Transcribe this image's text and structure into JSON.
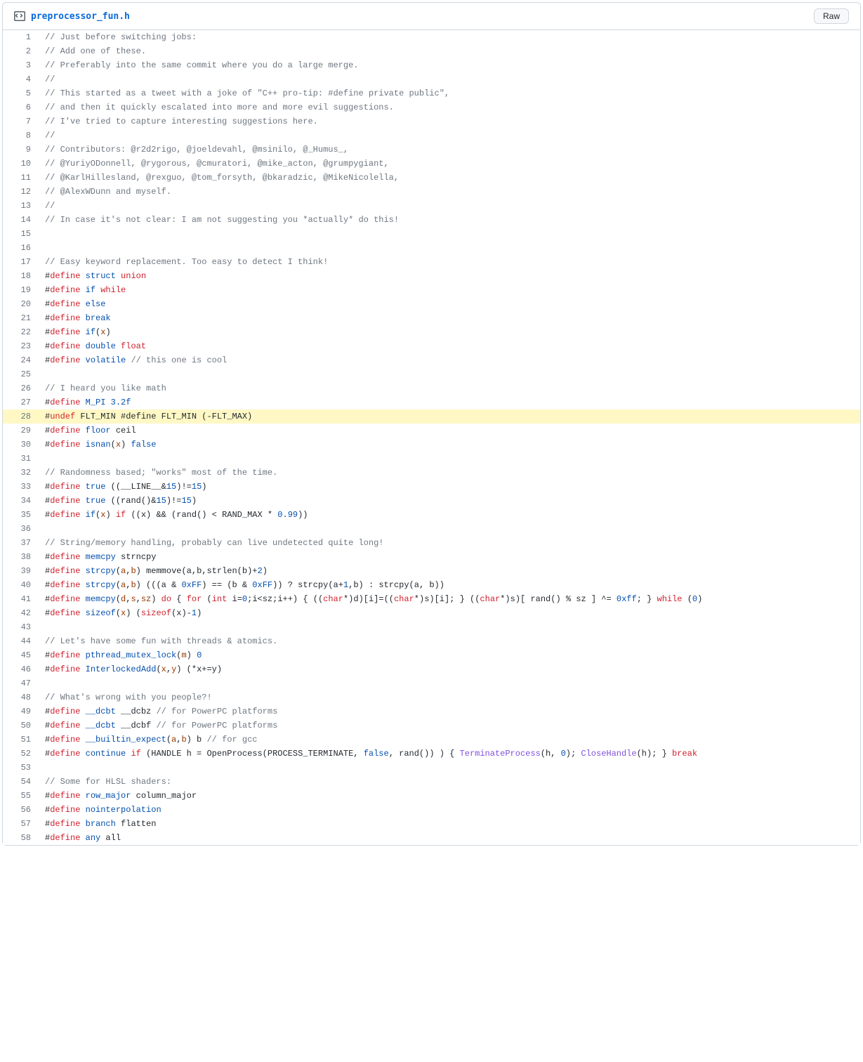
{
  "header": {
    "filename": "preprocessor_fun.h",
    "raw_label": "Raw"
  },
  "highlight_line": 28,
  "code": [
    {
      "n": 1,
      "t": [
        [
          "c-cm",
          "// Just before switching jobs:"
        ]
      ]
    },
    {
      "n": 2,
      "t": [
        [
          "c-cm",
          "// Add one of these."
        ]
      ]
    },
    {
      "n": 3,
      "t": [
        [
          "c-cm",
          "// Preferably into the same commit where you do a large merge."
        ]
      ]
    },
    {
      "n": 4,
      "t": [
        [
          "c-cm",
          "//"
        ]
      ]
    },
    {
      "n": 5,
      "t": [
        [
          "c-cm",
          "// This started as a tweet with a joke of \"C++ pro-tip: #define private public\","
        ]
      ]
    },
    {
      "n": 6,
      "t": [
        [
          "c-cm",
          "// and then it quickly escalated into more and more evil suggestions."
        ]
      ]
    },
    {
      "n": 7,
      "t": [
        [
          "c-cm",
          "// I've tried to capture interesting suggestions here."
        ]
      ]
    },
    {
      "n": 8,
      "t": [
        [
          "c-cm",
          "//"
        ]
      ]
    },
    {
      "n": 9,
      "t": [
        [
          "c-cm",
          "// Contributors: @r2d2rigo, @joeldevahl, @msinilo, @_Humus_,"
        ]
      ]
    },
    {
      "n": 10,
      "t": [
        [
          "c-cm",
          "// @YuriyODonnell, @rygorous, @cmuratori, @mike_acton, @grumpygiant,"
        ]
      ]
    },
    {
      "n": 11,
      "t": [
        [
          "c-cm",
          "// @KarlHillesland, @rexguo, @tom_forsyth, @bkaradzic, @MikeNicolella,"
        ]
      ]
    },
    {
      "n": 12,
      "t": [
        [
          "c-cm",
          "// @AlexWDunn and myself."
        ]
      ]
    },
    {
      "n": 13,
      "t": [
        [
          "c-cm",
          "//"
        ]
      ]
    },
    {
      "n": 14,
      "t": [
        [
          "c-cm",
          "// In case it's not clear: I am not suggesting you *actually* do this!"
        ]
      ]
    },
    {
      "n": 15,
      "t": [
        [
          "",
          ""
        ]
      ]
    },
    {
      "n": 16,
      "t": [
        [
          "",
          ""
        ]
      ]
    },
    {
      "n": 17,
      "t": [
        [
          "c-cm",
          "// Easy keyword replacement. Too easy to detect I think!"
        ]
      ]
    },
    {
      "n": 18,
      "t": [
        [
          "",
          "#"
        ],
        [
          "c-kw",
          "define"
        ],
        [
          "",
          " "
        ],
        [
          "c-nm",
          "struct"
        ],
        [
          "",
          " "
        ],
        [
          "c-kw",
          "union"
        ]
      ]
    },
    {
      "n": 19,
      "t": [
        [
          "",
          "#"
        ],
        [
          "c-kw",
          "define"
        ],
        [
          "",
          " "
        ],
        [
          "c-nm",
          "if"
        ],
        [
          "",
          " "
        ],
        [
          "c-kw",
          "while"
        ]
      ]
    },
    {
      "n": 20,
      "t": [
        [
          "",
          "#"
        ],
        [
          "c-kw",
          "define"
        ],
        [
          "",
          " "
        ],
        [
          "c-nm",
          "else"
        ]
      ]
    },
    {
      "n": 21,
      "t": [
        [
          "",
          "#"
        ],
        [
          "c-kw",
          "define"
        ],
        [
          "",
          " "
        ],
        [
          "c-nm",
          "break"
        ]
      ]
    },
    {
      "n": 22,
      "t": [
        [
          "",
          "#"
        ],
        [
          "c-kw",
          "define"
        ],
        [
          "",
          " "
        ],
        [
          "c-nm",
          "if"
        ],
        [
          "",
          "("
        ],
        [
          "c-var",
          "x"
        ],
        [
          "",
          ")"
        ]
      ]
    },
    {
      "n": 23,
      "t": [
        [
          "",
          "#"
        ],
        [
          "c-kw",
          "define"
        ],
        [
          "",
          " "
        ],
        [
          "c-nm",
          "double"
        ],
        [
          "",
          " "
        ],
        [
          "c-kw",
          "float"
        ]
      ]
    },
    {
      "n": 24,
      "t": [
        [
          "",
          "#"
        ],
        [
          "c-kw",
          "define"
        ],
        [
          "",
          " "
        ],
        [
          "c-nm",
          "volatile"
        ],
        [
          "",
          " "
        ],
        [
          "c-cm",
          "// this one is cool"
        ]
      ]
    },
    {
      "n": 25,
      "t": [
        [
          "",
          ""
        ]
      ]
    },
    {
      "n": 26,
      "t": [
        [
          "c-cm",
          "// I heard you like math"
        ]
      ]
    },
    {
      "n": 27,
      "t": [
        [
          "",
          "#"
        ],
        [
          "c-kw",
          "define"
        ],
        [
          "",
          " "
        ],
        [
          "c-nm",
          "M_PI"
        ],
        [
          "",
          " "
        ],
        [
          "c-num",
          "3.2f"
        ]
      ]
    },
    {
      "n": 28,
      "t": [
        [
          "",
          "#"
        ],
        [
          "c-kw",
          "undef"
        ],
        [
          "",
          " FLT_MIN #define FLT_MIN (-FLT_MAX)"
        ]
      ]
    },
    {
      "n": 29,
      "t": [
        [
          "",
          "#"
        ],
        [
          "c-kw",
          "define"
        ],
        [
          "",
          " "
        ],
        [
          "c-nm",
          "floor"
        ],
        [
          "",
          " ceil"
        ]
      ]
    },
    {
      "n": 30,
      "t": [
        [
          "",
          "#"
        ],
        [
          "c-kw",
          "define"
        ],
        [
          "",
          " "
        ],
        [
          "c-nm",
          "isnan"
        ],
        [
          "",
          "("
        ],
        [
          "c-var",
          "x"
        ],
        [
          "",
          ") "
        ],
        [
          "c-num",
          "false"
        ]
      ]
    },
    {
      "n": 31,
      "t": [
        [
          "",
          ""
        ]
      ]
    },
    {
      "n": 32,
      "t": [
        [
          "c-cm",
          "// Randomness based; \"works\" most of the time."
        ]
      ]
    },
    {
      "n": 33,
      "t": [
        [
          "",
          "#"
        ],
        [
          "c-kw",
          "define"
        ],
        [
          "",
          " "
        ],
        [
          "c-nm",
          "true"
        ],
        [
          "",
          " ((__LINE__&"
        ],
        [
          "c-num",
          "15"
        ],
        [
          "",
          ")!="
        ],
        [
          "c-num",
          "15"
        ],
        [
          "",
          ")"
        ]
      ]
    },
    {
      "n": 34,
      "t": [
        [
          "",
          "#"
        ],
        [
          "c-kw",
          "define"
        ],
        [
          "",
          " "
        ],
        [
          "c-nm",
          "true"
        ],
        [
          "",
          " ((rand()&"
        ],
        [
          "c-num",
          "15"
        ],
        [
          "",
          ")!="
        ],
        [
          "c-num",
          "15"
        ],
        [
          "",
          ")"
        ]
      ]
    },
    {
      "n": 35,
      "t": [
        [
          "",
          "#"
        ],
        [
          "c-kw",
          "define"
        ],
        [
          "",
          " "
        ],
        [
          "c-nm",
          "if"
        ],
        [
          "",
          "("
        ],
        [
          "c-var",
          "x"
        ],
        [
          "",
          ") "
        ],
        [
          "c-kw",
          "if"
        ],
        [
          "",
          " ((x) && (rand() < RAND_MAX * "
        ],
        [
          "c-num",
          "0.99"
        ],
        [
          "",
          "))"
        ]
      ]
    },
    {
      "n": 36,
      "t": [
        [
          "",
          ""
        ]
      ]
    },
    {
      "n": 37,
      "t": [
        [
          "c-cm",
          "// String/memory handling, probably can live undetected quite long!"
        ]
      ]
    },
    {
      "n": 38,
      "t": [
        [
          "",
          "#"
        ],
        [
          "c-kw",
          "define"
        ],
        [
          "",
          " "
        ],
        [
          "c-nm",
          "memcpy"
        ],
        [
          "",
          " strncpy"
        ]
      ]
    },
    {
      "n": 39,
      "t": [
        [
          "",
          "#"
        ],
        [
          "c-kw",
          "define"
        ],
        [
          "",
          " "
        ],
        [
          "c-nm",
          "strcpy"
        ],
        [
          "",
          "("
        ],
        [
          "c-var",
          "a"
        ],
        [
          "",
          ","
        ],
        [
          "c-var",
          "b"
        ],
        [
          "",
          ") memmove(a,b,strlen(b)+"
        ],
        [
          "c-num",
          "2"
        ],
        [
          "",
          ")"
        ]
      ]
    },
    {
      "n": 40,
      "t": [
        [
          "",
          "#"
        ],
        [
          "c-kw",
          "define"
        ],
        [
          "",
          " "
        ],
        [
          "c-nm",
          "strcpy"
        ],
        [
          "",
          "("
        ],
        [
          "c-var",
          "a"
        ],
        [
          "",
          ","
        ],
        [
          "c-var",
          "b"
        ],
        [
          "",
          ") (((a & "
        ],
        [
          "c-num",
          "0xFF"
        ],
        [
          "",
          ") == (b & "
        ],
        [
          "c-num",
          "0xFF"
        ],
        [
          "",
          ")) ? strcpy(a+"
        ],
        [
          "c-num",
          "1"
        ],
        [
          "",
          ",b) : strcpy(a, b))"
        ]
      ]
    },
    {
      "n": 41,
      "t": [
        [
          "",
          "#"
        ],
        [
          "c-kw",
          "define"
        ],
        [
          "",
          " "
        ],
        [
          "c-nm",
          "memcpy"
        ],
        [
          "",
          "("
        ],
        [
          "c-var",
          "d"
        ],
        [
          "",
          ","
        ],
        [
          "c-var",
          "s"
        ],
        [
          "",
          ","
        ],
        [
          "c-var",
          "sz"
        ],
        [
          "",
          ") "
        ],
        [
          "c-kw",
          "do"
        ],
        [
          "",
          " { "
        ],
        [
          "c-kw",
          "for"
        ],
        [
          "",
          " ("
        ],
        [
          "c-kw",
          "int"
        ],
        [
          "",
          " i="
        ],
        [
          "c-num",
          "0"
        ],
        [
          "",
          ";i<sz;i++) { (("
        ],
        [
          "c-kw",
          "char"
        ],
        [
          "",
          "*)d)[i]=(("
        ],
        [
          "c-kw",
          "char"
        ],
        [
          "",
          "*)s)[i]; } (("
        ],
        [
          "c-kw",
          "char"
        ],
        [
          "",
          "*)s)[ rand() % sz ] ^= "
        ],
        [
          "c-num",
          "0xff"
        ],
        [
          "",
          "; } "
        ],
        [
          "c-kw",
          "while"
        ],
        [
          "",
          " ("
        ],
        [
          "c-num",
          "0"
        ],
        [
          "",
          ")"
        ]
      ]
    },
    {
      "n": 42,
      "t": [
        [
          "",
          "#"
        ],
        [
          "c-kw",
          "define"
        ],
        [
          "",
          " "
        ],
        [
          "c-nm",
          "sizeof"
        ],
        [
          "",
          "("
        ],
        [
          "c-var",
          "x"
        ],
        [
          "",
          ") ("
        ],
        [
          "c-kw",
          "sizeof"
        ],
        [
          "",
          "(x)-"
        ],
        [
          "c-num",
          "1"
        ],
        [
          "",
          ")"
        ]
      ]
    },
    {
      "n": 43,
      "t": [
        [
          "",
          ""
        ]
      ]
    },
    {
      "n": 44,
      "t": [
        [
          "c-cm",
          "// Let's have some fun with threads & atomics."
        ]
      ]
    },
    {
      "n": 45,
      "t": [
        [
          "",
          "#"
        ],
        [
          "c-kw",
          "define"
        ],
        [
          "",
          " "
        ],
        [
          "c-nm",
          "pthread_mutex_lock"
        ],
        [
          "",
          "("
        ],
        [
          "c-var",
          "m"
        ],
        [
          "",
          ") "
        ],
        [
          "c-num",
          "0"
        ]
      ]
    },
    {
      "n": 46,
      "t": [
        [
          "",
          "#"
        ],
        [
          "c-kw",
          "define"
        ],
        [
          "",
          " "
        ],
        [
          "c-nm",
          "InterlockedAdd"
        ],
        [
          "",
          "("
        ],
        [
          "c-var",
          "x"
        ],
        [
          "",
          ","
        ],
        [
          "c-var",
          "y"
        ],
        [
          "",
          ") (*x+=y)"
        ]
      ]
    },
    {
      "n": 47,
      "t": [
        [
          "",
          ""
        ]
      ]
    },
    {
      "n": 48,
      "t": [
        [
          "c-cm",
          "// What's wrong with you people?!"
        ]
      ]
    },
    {
      "n": 49,
      "t": [
        [
          "",
          "#"
        ],
        [
          "c-kw",
          "define"
        ],
        [
          "",
          " "
        ],
        [
          "c-nm",
          "__dcbt"
        ],
        [
          "",
          " __dcbz "
        ],
        [
          "c-cm",
          "// for PowerPC platforms"
        ]
      ]
    },
    {
      "n": 50,
      "t": [
        [
          "",
          "#"
        ],
        [
          "c-kw",
          "define"
        ],
        [
          "",
          " "
        ],
        [
          "c-nm",
          "__dcbt"
        ],
        [
          "",
          " __dcbf "
        ],
        [
          "c-cm",
          "// for PowerPC platforms"
        ]
      ]
    },
    {
      "n": 51,
      "t": [
        [
          "",
          "#"
        ],
        [
          "c-kw",
          "define"
        ],
        [
          "",
          " "
        ],
        [
          "c-nm",
          "__builtin_expect"
        ],
        [
          "",
          "("
        ],
        [
          "c-var",
          "a"
        ],
        [
          "",
          ","
        ],
        [
          "c-var",
          "b"
        ],
        [
          "",
          ") b "
        ],
        [
          "c-cm",
          "// for gcc"
        ]
      ]
    },
    {
      "n": 52,
      "t": [
        [
          "",
          "#"
        ],
        [
          "c-kw",
          "define"
        ],
        [
          "",
          " "
        ],
        [
          "c-nm",
          "continue"
        ],
        [
          "",
          " "
        ],
        [
          "c-kw",
          "if"
        ],
        [
          "",
          " (HANDLE h = OpenProcess(PROCESS_TERMINATE, "
        ],
        [
          "c-num",
          "false"
        ],
        [
          "",
          ", rand()) ) { "
        ],
        [
          "c-fn",
          "TerminateProcess"
        ],
        [
          "",
          "(h, "
        ],
        [
          "c-num",
          "0"
        ],
        [
          "",
          "); "
        ],
        [
          "c-fn",
          "CloseHandle"
        ],
        [
          "",
          "(h); } "
        ],
        [
          "c-kw",
          "break"
        ]
      ]
    },
    {
      "n": 53,
      "t": [
        [
          "",
          ""
        ]
      ]
    },
    {
      "n": 54,
      "t": [
        [
          "c-cm",
          "// Some for HLSL shaders:"
        ]
      ]
    },
    {
      "n": 55,
      "t": [
        [
          "",
          "#"
        ],
        [
          "c-kw",
          "define"
        ],
        [
          "",
          " "
        ],
        [
          "c-nm",
          "row_major"
        ],
        [
          "",
          " column_major"
        ]
      ]
    },
    {
      "n": 56,
      "t": [
        [
          "",
          "#"
        ],
        [
          "c-kw",
          "define"
        ],
        [
          "",
          " "
        ],
        [
          "c-nm",
          "nointerpolation"
        ]
      ]
    },
    {
      "n": 57,
      "t": [
        [
          "",
          "#"
        ],
        [
          "c-kw",
          "define"
        ],
        [
          "",
          " "
        ],
        [
          "c-nm",
          "branch"
        ],
        [
          "",
          " flatten"
        ]
      ]
    },
    {
      "n": 58,
      "t": [
        [
          "",
          "#"
        ],
        [
          "c-kw",
          "define"
        ],
        [
          "",
          " "
        ],
        [
          "c-nm",
          "any"
        ],
        [
          "",
          " all"
        ]
      ]
    }
  ]
}
